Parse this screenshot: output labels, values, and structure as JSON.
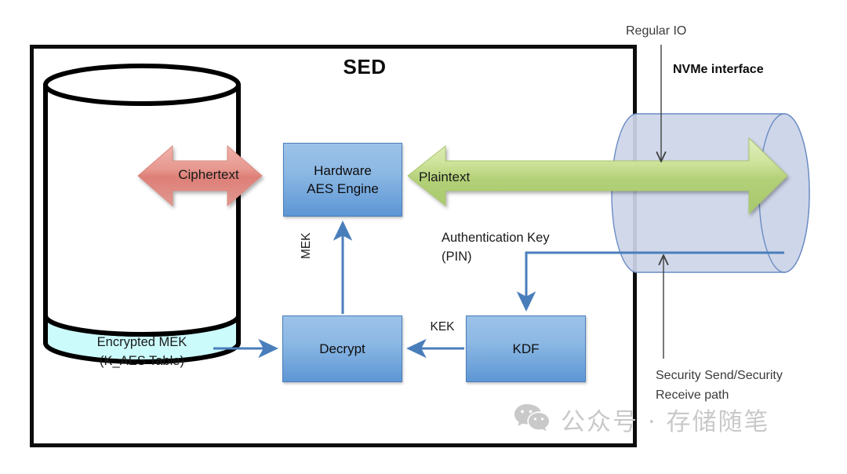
{
  "diagram": {
    "title": "SED",
    "frame_name": "SED",
    "storage": {
      "device_label_line1": "Encrypted MEK",
      "device_label_line2": "(K_AES Table)",
      "band_color": "#ccfbfb",
      "outline_color": "#000000"
    },
    "boxes": [
      {
        "id": "aes",
        "line1": "Hardware",
        "line2": "AES Engine"
      },
      {
        "id": "decrypt",
        "line1": "Decrypt",
        "line2": ""
      },
      {
        "id": "kdf",
        "line1": "KDF",
        "line2": ""
      }
    ],
    "flows": {
      "ciphertext": "Ciphertext",
      "plaintext": "Plaintext",
      "mek": "MEK",
      "kek": "KEK",
      "auth_key_line1": "Authentication Key",
      "auth_key_line2": "(PIN)"
    },
    "annotations": {
      "regular_io": "Regular IO",
      "nvme_interface": "NVMe interface",
      "security_path_line1": "Security Send/Security",
      "security_path_line2": "Receive path"
    },
    "colors": {
      "ciphertext_arrow": "#e08b84",
      "plaintext_arrow": "#b3d178",
      "box_blue_light": "#9cc2e8",
      "box_blue_dark": "#5d96d4",
      "connector_blue": "#4a7ebb",
      "interface_cylinder": "#ccd5e8",
      "mek_band_cyan": "#ccfbfb"
    }
  },
  "watermark": {
    "icon": "wechat-icon",
    "text": "公众号 · 存储随笔"
  }
}
